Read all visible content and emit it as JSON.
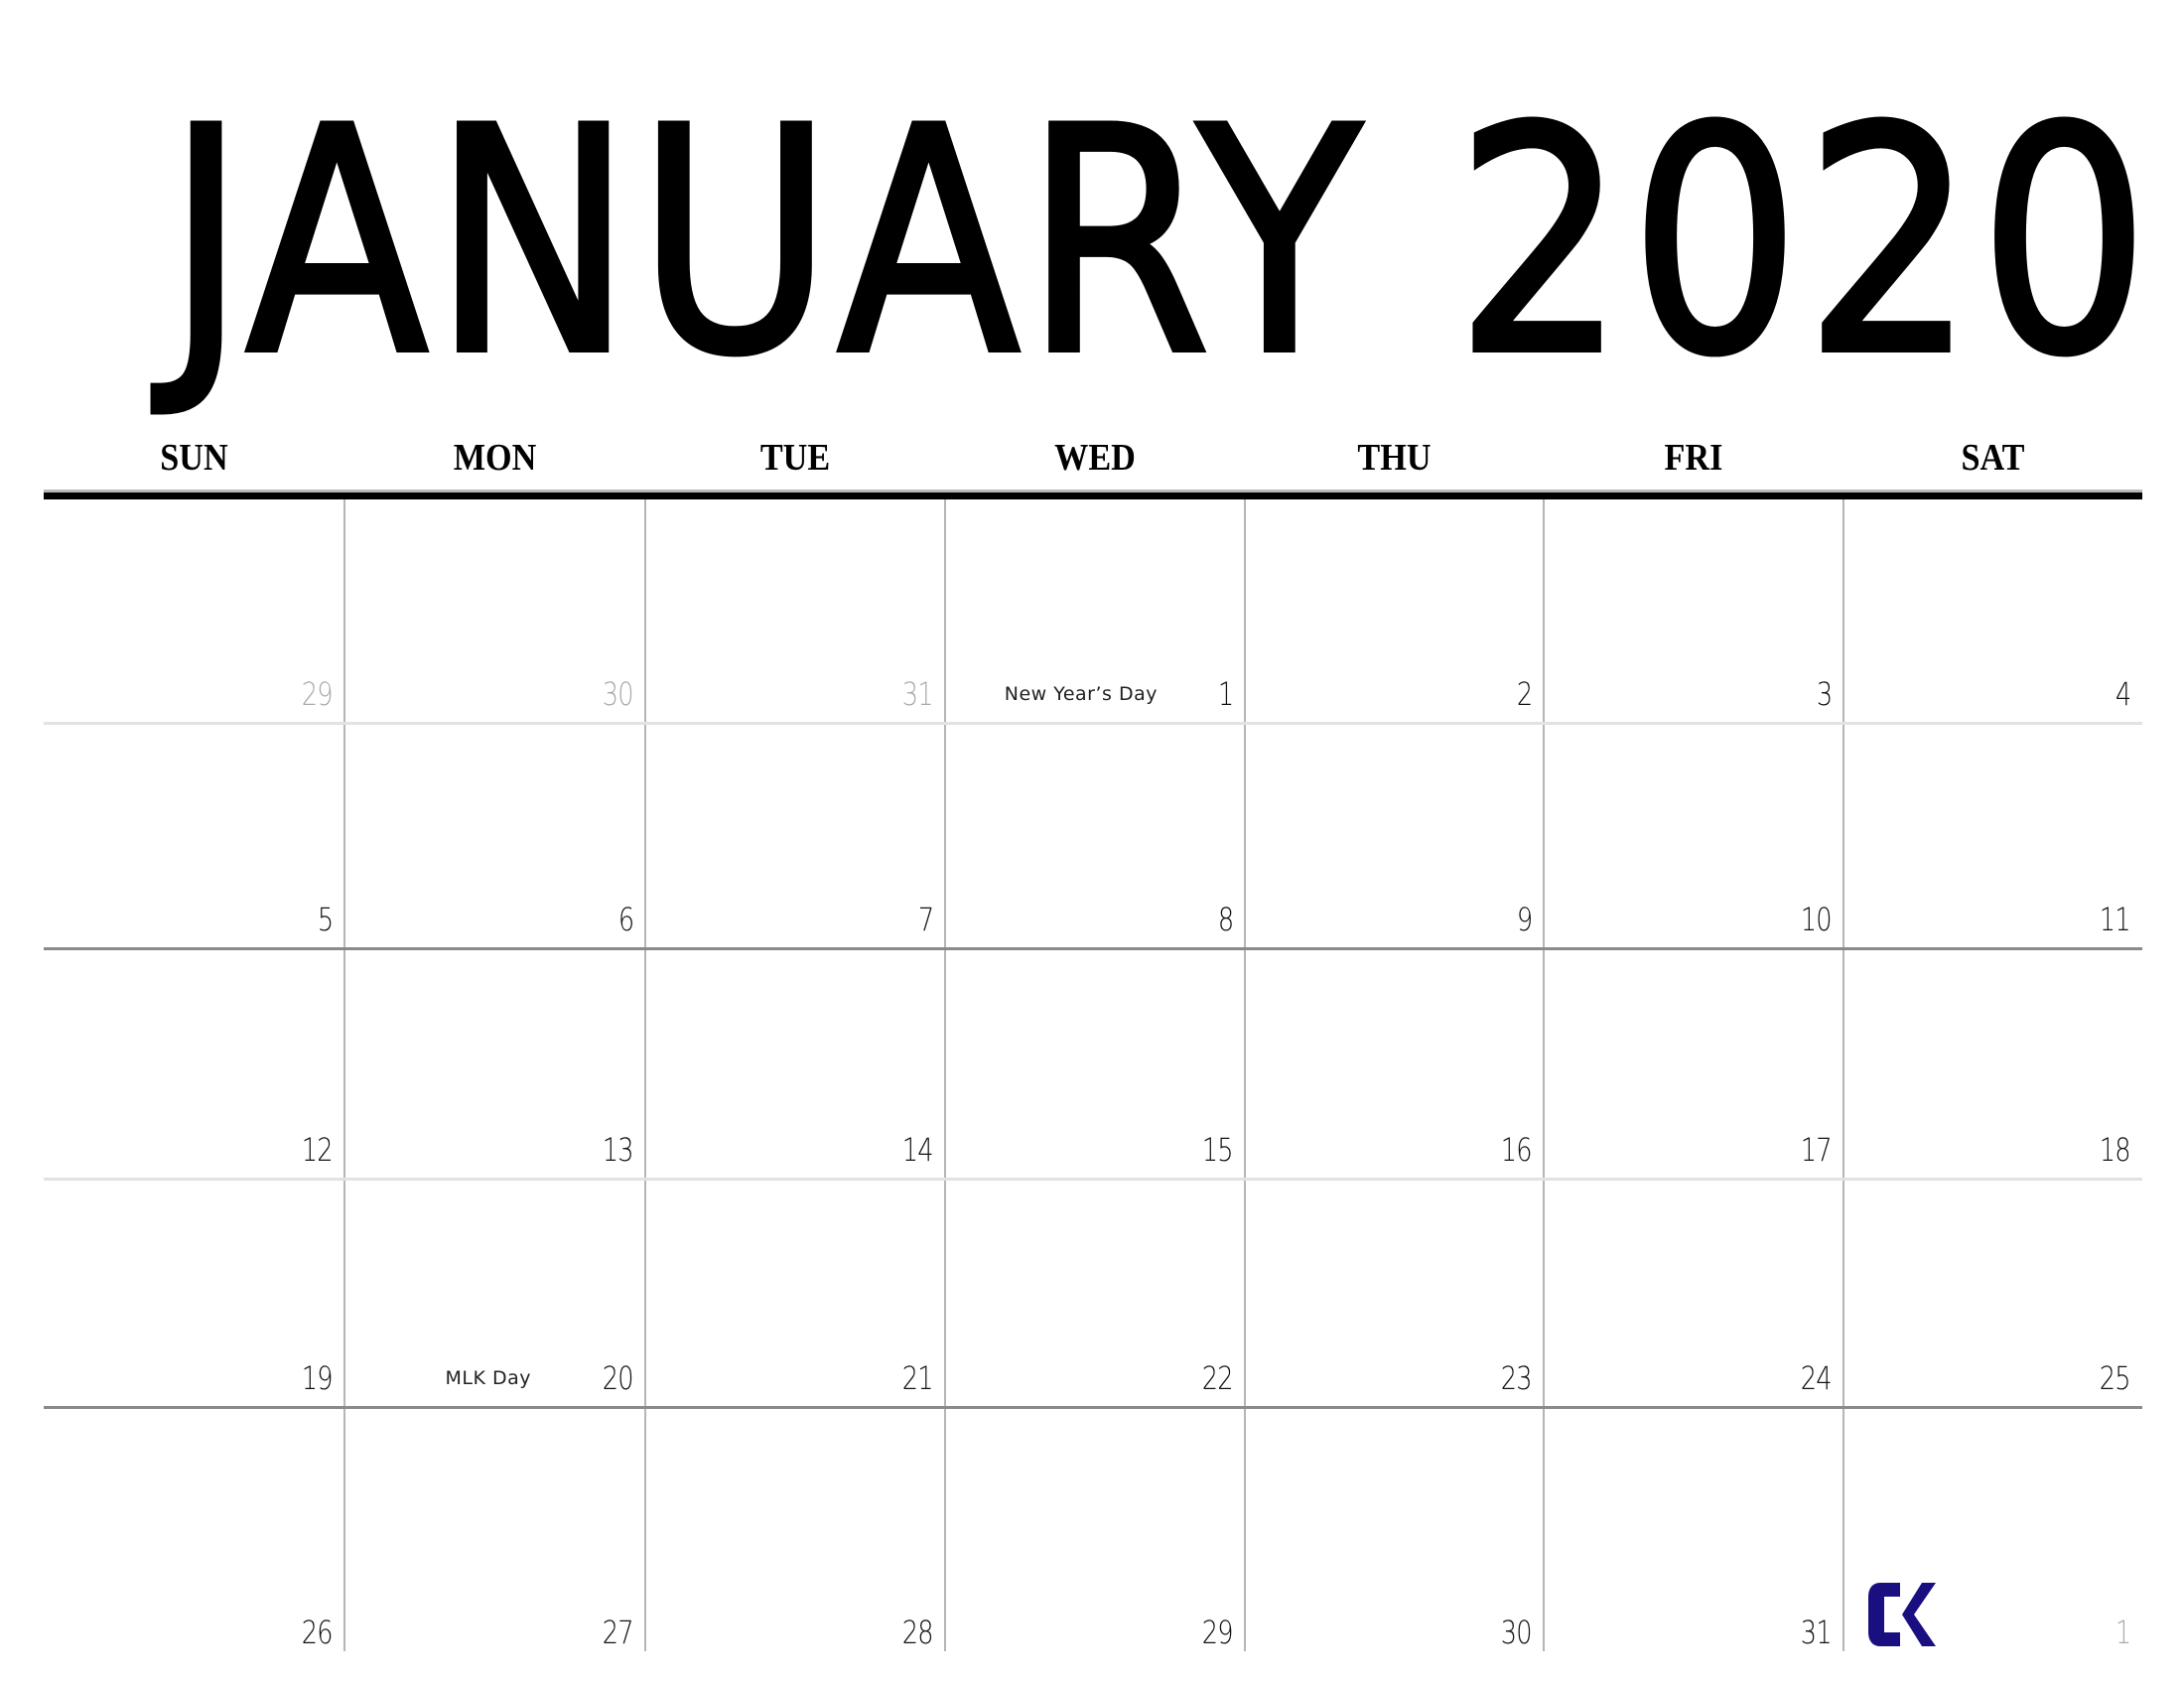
{
  "calendar": {
    "title": "JANUARY 2020",
    "month": "JANUARY",
    "year": "2020",
    "weekdays": [
      "SUN",
      "MON",
      "TUE",
      "WED",
      "THU",
      "FRI",
      "SAT"
    ],
    "weeks": [
      [
        {
          "day": "29",
          "muted": true
        },
        {
          "day": "30",
          "muted": true
        },
        {
          "day": "31",
          "muted": true
        },
        {
          "day": "1",
          "event": "New Year’s Day"
        },
        {
          "day": "2"
        },
        {
          "day": "3"
        },
        {
          "day": "4"
        }
      ],
      [
        {
          "day": "5"
        },
        {
          "day": "6"
        },
        {
          "day": "7"
        },
        {
          "day": "8"
        },
        {
          "day": "9"
        },
        {
          "day": "10"
        },
        {
          "day": "11"
        }
      ],
      [
        {
          "day": "12"
        },
        {
          "day": "13"
        },
        {
          "day": "14"
        },
        {
          "day": "15"
        },
        {
          "day": "16"
        },
        {
          "day": "17"
        },
        {
          "day": "18"
        }
      ],
      [
        {
          "day": "19"
        },
        {
          "day": "20",
          "event": "MLK Day"
        },
        {
          "day": "21"
        },
        {
          "day": "22"
        },
        {
          "day": "23"
        },
        {
          "day": "24"
        },
        {
          "day": "25"
        }
      ],
      [
        {
          "day": "26"
        },
        {
          "day": "27"
        },
        {
          "day": "28"
        },
        {
          "day": "29"
        },
        {
          "day": "30"
        },
        {
          "day": "31"
        },
        {
          "day": "1",
          "muted": true,
          "logo": true
        }
      ]
    ],
    "logo_text": "CK",
    "colors": {
      "text": "#000000",
      "muted": "#aaaaaa",
      "grid": "#b5b5b5",
      "logo": "#1a0f80"
    }
  }
}
